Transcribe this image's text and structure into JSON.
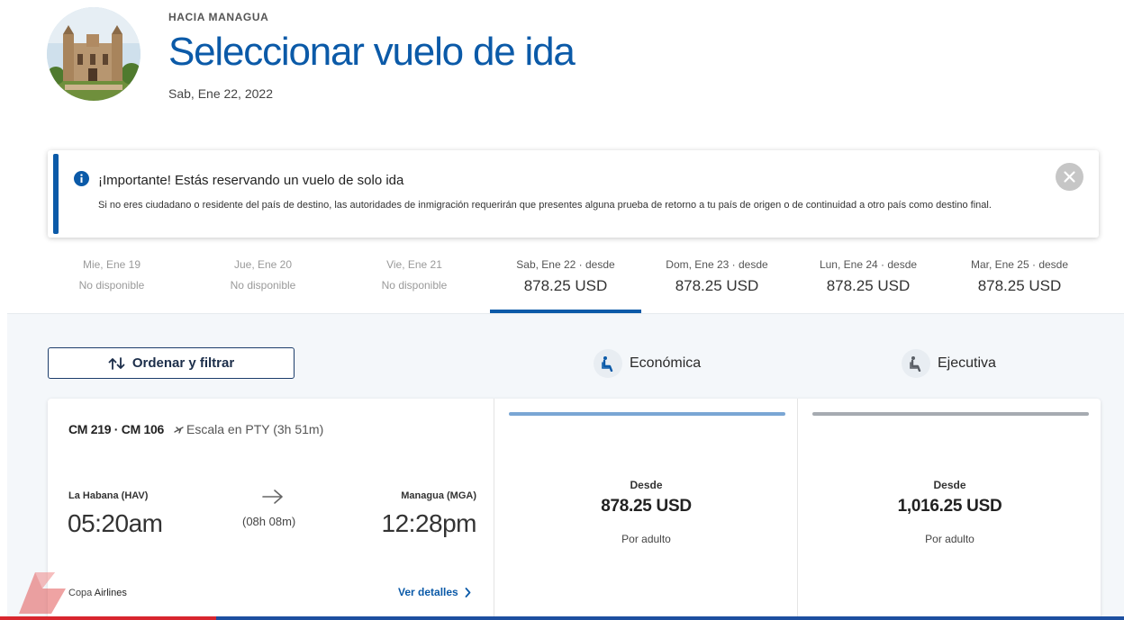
{
  "header": {
    "eyebrow": "HACIA MANAGUA",
    "title": "Seleccionar vuelo de ida",
    "date": "Sab, Ene 22, 2022"
  },
  "alert": {
    "title": "¡Importante! Estás reservando un vuelo de solo ida",
    "body": "Si no eres ciudadano o residente del país de destino, las autoridades de inmigración requerirán que presentes alguna prueba de retorno a tu país de origen o de continuidad a otro país como destino final.",
    "accent_color": "#0b5aa8"
  },
  "date_tabs": [
    {
      "label": "Mie, Ene 19",
      "value": "No disponible",
      "available": false,
      "active": false
    },
    {
      "label": "Jue, Ene 20",
      "value": "No disponible",
      "available": false,
      "active": false
    },
    {
      "label": "Vie, Ene 21",
      "value": "No disponible",
      "available": false,
      "active": false
    },
    {
      "label": "Sab, Ene 22 · desde",
      "value": "878.25 USD",
      "available": true,
      "active": true
    },
    {
      "label": "Dom, Ene 23 · desde",
      "value": "878.25 USD",
      "available": true,
      "active": false
    },
    {
      "label": "Lun, Ene 24 · desde",
      "value": "878.25 USD",
      "available": true,
      "active": false
    },
    {
      "label": "Mar, Ene 25 · desde",
      "value": "878.25 USD",
      "available": true,
      "active": false
    }
  ],
  "toolbar": {
    "sort_filter_label": "Ordenar y filtrar"
  },
  "cabins": {
    "economy_label": "Económica",
    "business_label": "Ejecutiva"
  },
  "flight": {
    "flight_numbers": "CM 219 · CM 106",
    "stop": "Escala en PTY (3h 51m)",
    "origin_city": "La Habana (HAV)",
    "departure_time": "05:20am",
    "duration": "(08h 08m)",
    "destination_city": "Managua (MGA)",
    "arrival_time": "12:28pm",
    "airline_prefix": "Copa ",
    "airline_suffix": "Airlines",
    "details_label": "Ver detalles",
    "fares": {
      "economy": {
        "from": "Desde",
        "price": "878.25 USD",
        "per": "Por adulto"
      },
      "business": {
        "from": "Desde",
        "price": "1,016.25 USD",
        "per": "Por adulto"
      }
    }
  },
  "colors": {
    "brand_blue": "#0b5aa8",
    "economy_bar": "#7aa6d4",
    "business_bar": "#a6abb1"
  }
}
